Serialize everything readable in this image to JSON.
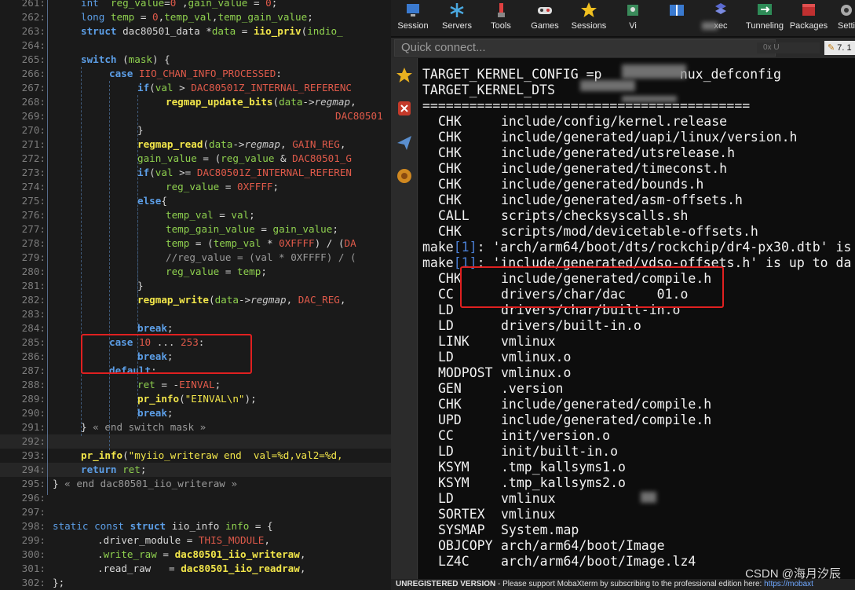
{
  "editor": {
    "lines": [
      {
        "n": "261:",
        "tokens": [
          [
            "ty",
            "int"
          ],
          [
            "op",
            "  "
          ],
          [
            "var",
            "reg_value"
          ],
          [
            "op",
            "="
          ],
          [
            "num",
            "0"
          ],
          [
            "op",
            " ,"
          ],
          [
            "var",
            "gain_value"
          ],
          [
            "op",
            " = "
          ],
          [
            "num",
            "0"
          ],
          [
            "op",
            ";"
          ]
        ]
      },
      {
        "n": "262:",
        "tokens": [
          [
            "ty",
            "long"
          ],
          [
            "op",
            " "
          ],
          [
            "var",
            "temp"
          ],
          [
            "op",
            " = "
          ],
          [
            "num",
            "0"
          ],
          [
            "op",
            ","
          ],
          [
            "var",
            "temp_val"
          ],
          [
            "op",
            ","
          ],
          [
            "var",
            "temp_gain_value"
          ],
          [
            "op",
            ";"
          ]
        ]
      },
      {
        "n": "263:",
        "tokens": [
          [
            "kw",
            "struct"
          ],
          [
            "op",
            " "
          ],
          [
            "id",
            "dac80501_data"
          ],
          [
            "op",
            " *"
          ],
          [
            "var",
            "data"
          ],
          [
            "op",
            " = "
          ],
          [
            "fn",
            "iio_priv"
          ],
          [
            "op",
            "("
          ],
          [
            "var",
            "indio_"
          ]
        ]
      },
      {
        "n": "264:",
        "tokens": []
      },
      {
        "n": "265:",
        "tokens": [
          [
            "kw",
            "switch"
          ],
          [
            "op",
            " ("
          ],
          [
            "var",
            "mask"
          ],
          [
            "op",
            ") {"
          ]
        ]
      },
      {
        "n": "266:",
        "tokens": [
          [
            "kw",
            "case"
          ],
          [
            "op",
            " "
          ],
          [
            "mac",
            "IIO_CHAN_INFO_PROCESSED"
          ],
          [
            "op",
            ":"
          ]
        ]
      },
      {
        "n": "267:",
        "tokens": [
          [
            "kw",
            "if"
          ],
          [
            "op",
            "("
          ],
          [
            "var",
            "val"
          ],
          [
            "op",
            " > "
          ],
          [
            "mac",
            "DAC80501Z_INTERNAL_REFERENC"
          ]
        ]
      },
      {
        "n": "268:",
        "tokens": [
          [
            "fn",
            "regmap_update_bits"
          ],
          [
            "op",
            "("
          ],
          [
            "var",
            "data"
          ],
          [
            "op",
            "->"
          ],
          [
            "mem",
            "regmap"
          ],
          [
            "op",
            ","
          ]
        ]
      },
      {
        "n": "269:",
        "tokens": [
          [
            "mac",
            "DAC80501"
          ]
        ]
      },
      {
        "n": "270:",
        "tokens": [
          [
            "op",
            "}"
          ]
        ]
      },
      {
        "n": "271:",
        "tokens": [
          [
            "fn",
            "regmap_read"
          ],
          [
            "op",
            "("
          ],
          [
            "var",
            "data"
          ],
          [
            "op",
            "->"
          ],
          [
            "mem",
            "regmap"
          ],
          [
            "op",
            ", "
          ],
          [
            "mac",
            "GAIN_REG"
          ],
          [
            "op",
            ","
          ]
        ]
      },
      {
        "n": "272:",
        "tokens": [
          [
            "var",
            "gain_value"
          ],
          [
            "op",
            " = ("
          ],
          [
            "var",
            "reg_value"
          ],
          [
            "op",
            " & "
          ],
          [
            "mac",
            "DAC80501_G"
          ]
        ]
      },
      {
        "n": "273:",
        "tokens": [
          [
            "kw",
            "if"
          ],
          [
            "op",
            "("
          ],
          [
            "var",
            "val"
          ],
          [
            "op",
            " >= "
          ],
          [
            "mac",
            "DAC80501Z_INTERNAL_REFEREN"
          ]
        ]
      },
      {
        "n": "274:",
        "tokens": [
          [
            "var",
            "reg_value"
          ],
          [
            "op",
            " = "
          ],
          [
            "num",
            "0XFFFF"
          ],
          [
            "op",
            ";"
          ]
        ]
      },
      {
        "n": "275:",
        "tokens": [
          [
            "kw",
            "else"
          ],
          [
            "op",
            "{"
          ]
        ]
      },
      {
        "n": "276:",
        "tokens": [
          [
            "var",
            "temp_val"
          ],
          [
            "op",
            " = "
          ],
          [
            "var",
            "val"
          ],
          [
            "op",
            ";"
          ]
        ]
      },
      {
        "n": "277:",
        "tokens": [
          [
            "var",
            "temp_gain_value"
          ],
          [
            "op",
            " = "
          ],
          [
            "var",
            "gain_value"
          ],
          [
            "op",
            ";"
          ]
        ]
      },
      {
        "n": "278:",
        "tokens": [
          [
            "var",
            "temp"
          ],
          [
            "op",
            " = ("
          ],
          [
            "var",
            "temp_val"
          ],
          [
            "op",
            " * "
          ],
          [
            "num",
            "0XFFFF"
          ],
          [
            "op",
            ") / ("
          ],
          [
            "mac",
            "DA"
          ]
        ]
      },
      {
        "n": "279:",
        "tokens": [
          [
            "cmt",
            "//reg_value = (val * 0XFFFF) / ("
          ]
        ]
      },
      {
        "n": "280:",
        "tokens": [
          [
            "var",
            "reg_value"
          ],
          [
            "op",
            " = "
          ],
          [
            "var",
            "temp"
          ],
          [
            "op",
            ";"
          ]
        ]
      },
      {
        "n": "281:",
        "tokens": [
          [
            "op",
            "}"
          ]
        ]
      },
      {
        "n": "282:",
        "tokens": [
          [
            "fn",
            "regmap_write"
          ],
          [
            "op",
            "("
          ],
          [
            "var",
            "data"
          ],
          [
            "op",
            "->"
          ],
          [
            "mem",
            "regmap"
          ],
          [
            "op",
            ", "
          ],
          [
            "mac",
            "DAC_REG"
          ],
          [
            "op",
            ","
          ]
        ]
      },
      {
        "n": "283:",
        "tokens": []
      },
      {
        "n": "284:",
        "tokens": [
          [
            "kw",
            "break"
          ],
          [
            "op",
            ";"
          ]
        ]
      },
      {
        "n": "285:",
        "tokens": [
          [
            "kw",
            "case"
          ],
          [
            "op",
            " "
          ],
          [
            "num",
            "10"
          ],
          [
            "op",
            " ... "
          ],
          [
            "num",
            "253"
          ],
          [
            "op",
            ":"
          ]
        ]
      },
      {
        "n": "286:",
        "tokens": [
          [
            "kw",
            "break"
          ],
          [
            "op",
            ";"
          ]
        ]
      },
      {
        "n": "287:",
        "tokens": [
          [
            "kw",
            "default"
          ],
          [
            "op",
            ":"
          ]
        ]
      },
      {
        "n": "288:",
        "tokens": [
          [
            "var",
            "ret"
          ],
          [
            "op",
            " = -"
          ],
          [
            "mac",
            "EINVAL"
          ],
          [
            "op",
            ";"
          ]
        ]
      },
      {
        "n": "289:",
        "tokens": [
          [
            "fn",
            "pr_info"
          ],
          [
            "op",
            "("
          ],
          [
            "str",
            "\"EINVAL\\n\""
          ],
          [
            "op",
            ");"
          ]
        ]
      },
      {
        "n": "290:",
        "tokens": [
          [
            "kw",
            "break"
          ],
          [
            "op",
            ";"
          ]
        ]
      },
      {
        "n": "291:",
        "tokens": [
          [
            "op",
            "} "
          ],
          [
            "cmt",
            "« end switch mask »"
          ]
        ]
      },
      {
        "n": "292:",
        "tokens": []
      },
      {
        "n": "293:",
        "tokens": [
          [
            "fn",
            "pr_info"
          ],
          [
            "op",
            "("
          ],
          [
            "str",
            "\"myiio_writeraw end  val=%d,val2=%d,"
          ]
        ]
      },
      {
        "n": "294:",
        "tokens": [
          [
            "kw",
            "return"
          ],
          [
            "op",
            " "
          ],
          [
            "var",
            "ret"
          ],
          [
            "op",
            ";"
          ]
        ]
      },
      {
        "n": "295:",
        "tokens": [
          [
            "op",
            "} "
          ],
          [
            "cmt",
            "« end dac80501_iio_writeraw »"
          ]
        ]
      },
      {
        "n": "296:",
        "tokens": []
      },
      {
        "n": "297:",
        "tokens": []
      },
      {
        "n": "298:",
        "tokens": [
          [
            "ty",
            "static"
          ],
          [
            "op",
            " "
          ],
          [
            "ty",
            "const"
          ],
          [
            "op",
            " "
          ],
          [
            "kw",
            "struct"
          ],
          [
            "op",
            " "
          ],
          [
            "id",
            "iio_info"
          ],
          [
            "op",
            " "
          ],
          [
            "var",
            "info"
          ],
          [
            "op",
            " = {"
          ]
        ]
      },
      {
        "n": "299:",
        "tokens": [
          [
            "op",
            "."
          ],
          [
            "id",
            "driver_module"
          ],
          [
            "op",
            " = "
          ],
          [
            "mac",
            "THIS_MODULE"
          ],
          [
            "op",
            ","
          ]
        ]
      },
      {
        "n": "300:",
        "tokens": [
          [
            "op",
            "."
          ],
          [
            "var",
            "write_raw"
          ],
          [
            "op",
            " = "
          ],
          [
            "fn",
            "dac80501_iio_writeraw"
          ],
          [
            "op",
            ","
          ]
        ]
      },
      {
        "n": "301:",
        "tokens": [
          [
            "op",
            "."
          ],
          [
            "id",
            "read_raw"
          ],
          [
            "op",
            "   = "
          ],
          [
            "fn",
            "dac80501_iio_readraw"
          ],
          [
            "op",
            ","
          ]
        ]
      },
      {
        "n": "302:",
        "tokens": [
          [
            "op",
            "};"
          ]
        ]
      }
    ]
  },
  "toolbar": {
    "items": [
      "Session",
      "Servers",
      "Tools",
      "Games",
      "Sessions",
      "View",
      "Split",
      "MultiExec",
      "Tunneling",
      "Packages",
      "Settings"
    ],
    "labels_visible": [
      "Session",
      "Servers",
      "Tools",
      "Games",
      "Sessions",
      "Vi",
      "",
      "xec",
      "Tunneling",
      "Packages",
      "Setti"
    ]
  },
  "quick_connect": {
    "placeholder": "Quick connect..."
  },
  "tabs": {
    "blurred": "0x U",
    "active": "7. 1"
  },
  "terminal": {
    "header": [
      "TARGET_KERNEL_CONFIG =p          nux_defconfig",
      "TARGET_KERNEL_DTS",
      "=========================================="
    ],
    "rows": [
      [
        "CHK",
        "include/config/kernel.release"
      ],
      [
        "CHK",
        "include/generated/uapi/linux/version.h"
      ],
      [
        "CHK",
        "include/generated/utsrelease.h"
      ],
      [
        "CHK",
        "include/generated/timeconst.h"
      ],
      [
        "CHK",
        "include/generated/bounds.h"
      ],
      [
        "CHK",
        "include/generated/asm-offsets.h"
      ],
      [
        "CALL",
        "scripts/checksyscalls.sh"
      ],
      [
        "CHK",
        "scripts/mod/devicetable-offsets.h"
      ],
      [
        "make[1]:",
        "'arch/arm64/boot/dts/rockchip/dr4-px30.dtb' is"
      ],
      [
        "make[1]:",
        "'include/generated/vdso-offsets.h' is up to da"
      ],
      [
        "CHK",
        "include/generated/compile.h"
      ],
      [
        "CC",
        "drivers/char/dac    01.o"
      ],
      [
        "LD",
        "drivers/char/built-in.o"
      ],
      [
        "LD",
        "drivers/built-in.o"
      ],
      [
        "LINK",
        "vmlinux"
      ],
      [
        "LD",
        "vmlinux.o"
      ],
      [
        "MODPOST",
        "vmlinux.o"
      ],
      [
        "GEN",
        ".version"
      ],
      [
        "CHK",
        "include/generated/compile.h"
      ],
      [
        "UPD",
        "include/generated/compile.h"
      ],
      [
        "CC",
        "init/version.o"
      ],
      [
        "LD",
        "init/built-in.o"
      ],
      [
        "KSYM",
        ".tmp_kallsyms1.o"
      ],
      [
        "KSYM",
        ".tmp_kallsyms2.o"
      ],
      [
        "LD",
        "vmlinux"
      ],
      [
        "SORTEX",
        "vmlinux"
      ],
      [
        "SYSMAP",
        "System.map"
      ],
      [
        "OBJCOPY",
        "arch/arm64/boot/Image"
      ],
      [
        "LZ4C",
        "arch/arm64/boot/Image.lz4"
      ]
    ]
  },
  "status": {
    "unregistered": "UNREGISTERED VERSION",
    "message": " -  Please support MobaXterm by subscribing to the professional edition here: ",
    "link": "https://mobaxt"
  },
  "watermark": "CSDN @海月汐辰",
  "colors": {
    "accent_red": "#e02020",
    "keyword_blue": "#5c9ee6",
    "function_yellow": "#f2e64a",
    "var_green": "#8fd14f"
  }
}
